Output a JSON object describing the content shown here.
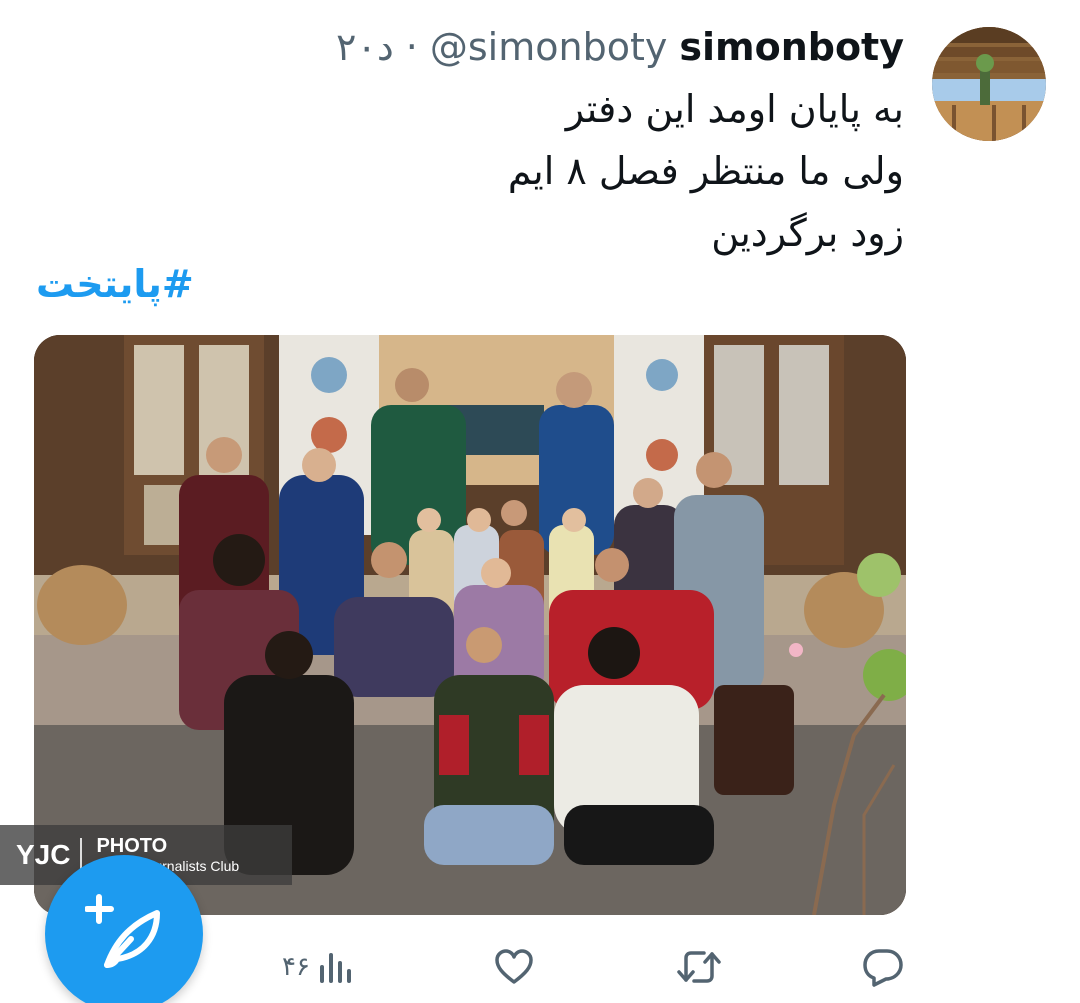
{
  "tweet": {
    "display_name": "simonboty",
    "handle": "@simonboty",
    "separator": "·",
    "time": "۲۰د",
    "lines": [
      "به پایان اومد این دفتر",
      "ولی ما منتظر فصل ۸ ایم",
      "زود برگردین"
    ],
    "hashtag": "#پایتخت"
  },
  "media": {
    "watermark_logo": "YJC",
    "watermark_title": "PHOTO",
    "watermark_subtitle": "Young Journalists Club"
  },
  "actions": {
    "views_count": "۴۶"
  },
  "icons": {
    "reply": "reply-icon",
    "retweet": "retweet-icon",
    "like": "like-icon",
    "views": "views-icon",
    "compose": "compose-tweet-icon"
  },
  "colors": {
    "accent": "#1d9bf0",
    "muted": "#536471",
    "text": "#0f1419"
  }
}
